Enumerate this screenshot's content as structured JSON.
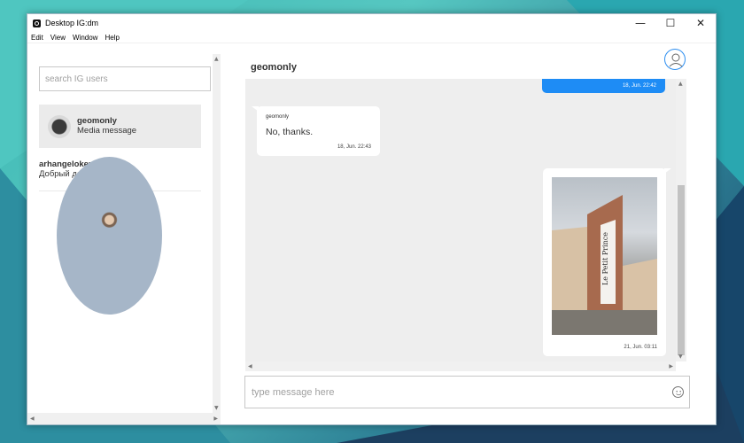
{
  "window": {
    "title": "Desktop IG:dm"
  },
  "window_controls": {
    "minimize": "—",
    "maximize": "☐",
    "close": "✕"
  },
  "menu": [
    "Edit",
    "View",
    "Window",
    "Help"
  ],
  "sidebar": {
    "search_placeholder": "search IG users",
    "conversations": [
      {
        "name": "geomonly",
        "preview": "Media message",
        "active": true,
        "avatar": "dark-circle-avatar"
      },
      {
        "name": "arhangelokey",
        "preview": "Добрый день!",
        "active": false,
        "avatar": "photo-avatar"
      }
    ]
  },
  "chat": {
    "title": "geomonly",
    "messages": [
      {
        "direction": "outgoing",
        "type": "text",
        "time": "18, Jun. 22:42"
      },
      {
        "direction": "incoming",
        "sender": "geomonly",
        "text": "No, thanks.",
        "time": "18, Jun. 22:43"
      },
      {
        "direction": "outgoing",
        "type": "image",
        "image_caption": "Le Petit Prince",
        "time": "21, Jun. 03:11"
      }
    ],
    "composer_placeholder": "type message here"
  },
  "colors": {
    "accent": "#1e8cf5",
    "chat_background": "#eeeeee",
    "active_conversation": "#ebebeb"
  },
  "icons": [
    "app-icon",
    "profile-icon",
    "emoji-icon"
  ]
}
